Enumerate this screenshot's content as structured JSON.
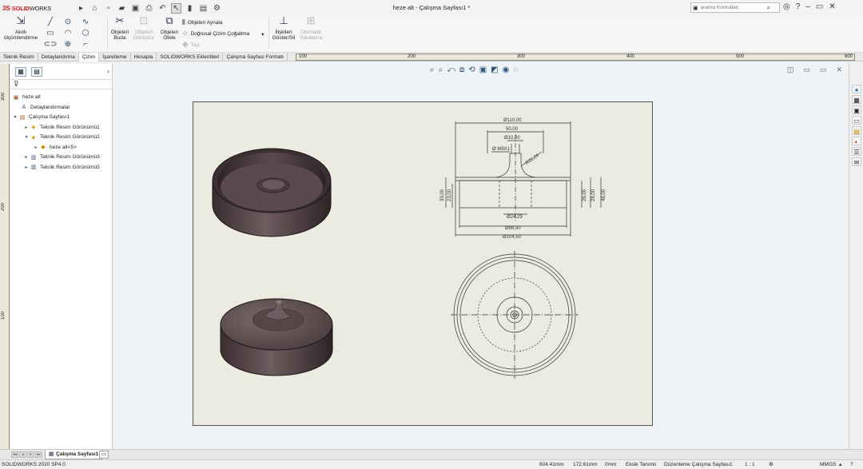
{
  "app": {
    "logo_prefix": "3S",
    "logo_name_a": "SOLID",
    "logo_name_b": "WORKS",
    "document_title": "heze alt - Çalışma Sayfası1 *",
    "search_placeholder": "arama Komutları"
  },
  "ribbon": {
    "smart_dim_line1": "Akıllı",
    "smart_dim_line2": "ölçümlendirme",
    "trim_line1": "Objeleri",
    "trim_line2": "Buda",
    "convert_line1": "Objeleri",
    "convert_line2": "Dönüştür",
    "offset_line1": "Objeleri",
    "offset_line2": "Ötele",
    "mirror": "Objeleri Aynala",
    "linear_pattern": "Doğrusal Çizim Çoğaltma",
    "move": "Taşı",
    "relations_line1": "İlişkileri",
    "relations_line2": "Göster/Sil",
    "autofix_line1": "Otomatik",
    "autofix_line2": "Yakalama"
  },
  "tabs": [
    {
      "label": "Teknik Resim"
    },
    {
      "label": "Detaylandırma"
    },
    {
      "label": "Çizim"
    },
    {
      "label": "İşaretleme"
    },
    {
      "label": "Hesapla"
    },
    {
      "label": "SOLIDWORKS Eklentileri"
    },
    {
      "label": "Çalışma Sayfası Formatı"
    }
  ],
  "rulers": {
    "h_ticks": [
      "100",
      "200",
      "300",
      "400",
      "500",
      "600"
    ],
    "v_ticks": [
      "300",
      "200",
      "100"
    ]
  },
  "tree": {
    "root": "heze alt",
    "annotations": "Detaylandırmalar",
    "sheet": "Çalışma Sayfası1",
    "views": [
      "Teknik Resim Görünümü1",
      "Teknik Resim Görünümü2",
      "Teknik Resim Görünümü3",
      "Teknik Resim Görünümü5"
    ],
    "part": "heze alt<5>"
  },
  "drawing": {
    "dims": {
      "d110": "Ø110,00",
      "d50": "50,00",
      "d10": "Ø10,00",
      "m9": "Ø M9X1",
      "angle": "R31,24",
      "h33": "33,00",
      "h23": "23,00",
      "h26": "26,00",
      "h28": "28,00",
      "h48": "48,00",
      "d24": "Ø24,29",
      "d98": "Ø98,50",
      "d104": "Ø104,50"
    }
  },
  "sheet_tab": "Çalışma Sayfası1",
  "status": {
    "version": "SOLIDWORKS 2020 SP4.0",
    "x": "604.41mm",
    "y": "172.61mm",
    "z": "0mm",
    "definition": "Eksik Tanımlı",
    "editing": "Düzenleme Çalışma Sayfası1",
    "scale": "1 : 1",
    "units": "MMGS"
  }
}
